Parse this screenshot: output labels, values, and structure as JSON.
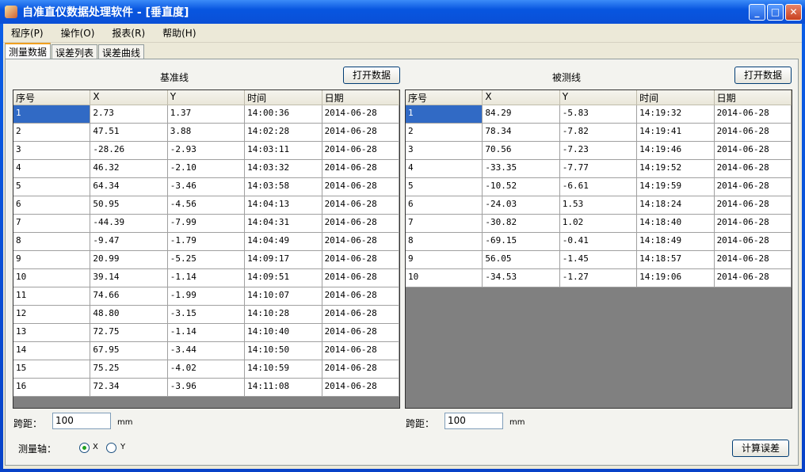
{
  "window": {
    "title": "自准直仪数据处理软件 - [垂直度]"
  },
  "menu": [
    "程序(P)",
    "操作(O)",
    "报表(R)",
    "帮助(H)"
  ],
  "tabs": [
    "测量数据",
    "误差列表",
    "误差曲线"
  ],
  "left": {
    "title": "基准线",
    "open_label": "打开数据",
    "span_label": "跨距：",
    "span_value": "100",
    "unit": "mm",
    "columns": [
      "序号",
      "X",
      "Y",
      "时间",
      "日期"
    ],
    "rows": [
      [
        "1",
        "2.73",
        "1.37",
        "14:00:36",
        "2014-06-28"
      ],
      [
        "2",
        "47.51",
        "3.88",
        "14:02:28",
        "2014-06-28"
      ],
      [
        "3",
        "-28.26",
        "-2.93",
        "14:03:11",
        "2014-06-28"
      ],
      [
        "4",
        "46.32",
        "-2.10",
        "14:03:32",
        "2014-06-28"
      ],
      [
        "5",
        "64.34",
        "-3.46",
        "14:03:58",
        "2014-06-28"
      ],
      [
        "6",
        "50.95",
        "-4.56",
        "14:04:13",
        "2014-06-28"
      ],
      [
        "7",
        "-44.39",
        "-7.99",
        "14:04:31",
        "2014-06-28"
      ],
      [
        "8",
        "-9.47",
        "-1.79",
        "14:04:49",
        "2014-06-28"
      ],
      [
        "9",
        "20.99",
        "-5.25",
        "14:09:17",
        "2014-06-28"
      ],
      [
        "10",
        "39.14",
        "-1.14",
        "14:09:51",
        "2014-06-28"
      ],
      [
        "11",
        "74.66",
        "-1.99",
        "14:10:07",
        "2014-06-28"
      ],
      [
        "12",
        "48.80",
        "-3.15",
        "14:10:28",
        "2014-06-28"
      ],
      [
        "13",
        "72.75",
        "-1.14",
        "14:10:40",
        "2014-06-28"
      ],
      [
        "14",
        "67.95",
        "-3.44",
        "14:10:50",
        "2014-06-28"
      ],
      [
        "15",
        "75.25",
        "-4.02",
        "14:10:59",
        "2014-06-28"
      ],
      [
        "16",
        "72.34",
        "-3.96",
        "14:11:08",
        "2014-06-28"
      ]
    ]
  },
  "right": {
    "title": "被测线",
    "open_label": "打开数据",
    "span_label": "跨距：",
    "span_value": "100",
    "unit": "mm",
    "columns": [
      "序号",
      "X",
      "Y",
      "时间",
      "日期"
    ],
    "rows": [
      [
        "1",
        "84.29",
        "-5.83",
        "14:19:32",
        "2014-06-28"
      ],
      [
        "2",
        "78.34",
        "-7.82",
        "14:19:41",
        "2014-06-28"
      ],
      [
        "3",
        "70.56",
        "-7.23",
        "14:19:46",
        "2014-06-28"
      ],
      [
        "4",
        "-33.35",
        "-7.77",
        "14:19:52",
        "2014-06-28"
      ],
      [
        "5",
        "-10.52",
        "-6.61",
        "14:19:59",
        "2014-06-28"
      ],
      [
        "6",
        "-24.03",
        "1.53",
        "14:18:24",
        "2014-06-28"
      ],
      [
        "7",
        "-30.82",
        "1.02",
        "14:18:40",
        "2014-06-28"
      ],
      [
        "8",
        "-69.15",
        "-0.41",
        "14:18:49",
        "2014-06-28"
      ],
      [
        "9",
        "56.05",
        "-1.45",
        "14:18:57",
        "2014-06-28"
      ],
      [
        "10",
        "-34.53",
        "-1.27",
        "14:19:06",
        "2014-06-28"
      ]
    ]
  },
  "axis": {
    "label": "测量轴：",
    "options": [
      "X",
      "Y"
    ],
    "selected": "X"
  },
  "calc_label": "计算误差"
}
